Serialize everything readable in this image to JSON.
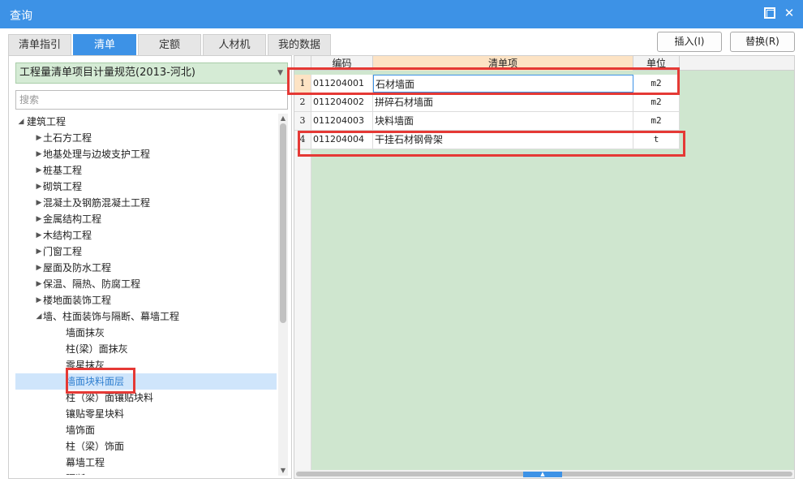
{
  "window": {
    "title": "查询"
  },
  "tabs": [
    {
      "label": "清单指引",
      "active": false
    },
    {
      "label": "清单",
      "active": true
    },
    {
      "label": "定额",
      "active": false
    },
    {
      "label": "人材机",
      "active": false
    },
    {
      "label": "我的数据",
      "active": false
    }
  ],
  "actions": {
    "insert_label": "插入(I)",
    "replace_label": "替换(R)"
  },
  "left": {
    "spec_select": "工程量清单项目计量规范(2013-河北)",
    "search_placeholder": "搜索",
    "tree": [
      {
        "label": "建筑工程",
        "level": 0,
        "state": "expanded"
      },
      {
        "label": "土石方工程",
        "level": 1,
        "state": "collapsed"
      },
      {
        "label": "地基处理与边坡支护工程",
        "level": 1,
        "state": "collapsed"
      },
      {
        "label": "桩基工程",
        "level": 1,
        "state": "collapsed"
      },
      {
        "label": "砌筑工程",
        "level": 1,
        "state": "collapsed"
      },
      {
        "label": "混凝土及钢筋混凝土工程",
        "level": 1,
        "state": "collapsed"
      },
      {
        "label": "金属结构工程",
        "level": 1,
        "state": "collapsed"
      },
      {
        "label": "木结构工程",
        "level": 1,
        "state": "collapsed"
      },
      {
        "label": "门窗工程",
        "level": 1,
        "state": "collapsed"
      },
      {
        "label": "屋面及防水工程",
        "level": 1,
        "state": "collapsed"
      },
      {
        "label": "保温、隔热、防腐工程",
        "level": 1,
        "state": "collapsed"
      },
      {
        "label": "楼地面装饰工程",
        "level": 1,
        "state": "collapsed"
      },
      {
        "label": "墙、柱面装饰与隔断、幕墙工程",
        "level": 1,
        "state": "expanded"
      },
      {
        "label": "墙面抹灰",
        "level": 2,
        "state": "leaf"
      },
      {
        "label": "柱(梁）面抹灰",
        "level": 2,
        "state": "leaf"
      },
      {
        "label": "零星抹灰",
        "level": 2,
        "state": "leaf"
      },
      {
        "label": "墙面块料面层",
        "level": 2,
        "state": "leaf",
        "selected": true
      },
      {
        "label": "柱（梁）面镶贴块料",
        "level": 2,
        "state": "leaf"
      },
      {
        "label": "镶贴零星块料",
        "level": 2,
        "state": "leaf"
      },
      {
        "label": "墙饰面",
        "level": 2,
        "state": "leaf"
      },
      {
        "label": "柱（梁）饰面",
        "level": 2,
        "state": "leaf"
      },
      {
        "label": "幕墙工程",
        "level": 2,
        "state": "leaf"
      },
      {
        "label": "隔断",
        "level": 2,
        "state": "leaf"
      }
    ]
  },
  "grid": {
    "columns": [
      "编码",
      "清单项",
      "单位"
    ],
    "rows": [
      {
        "num": "1",
        "code": "011204001",
        "name": "石材墙面",
        "unit": "m2"
      },
      {
        "num": "2",
        "code": "011204002",
        "name": "拼碎石材墙面",
        "unit": "m2"
      },
      {
        "num": "3",
        "code": "011204003",
        "name": "块料墙面",
        "unit": "m2"
      },
      {
        "num": "4",
        "code": "011204004",
        "name": "干挂石材钢骨架",
        "unit": "t"
      }
    ]
  },
  "icons": {
    "maximize": "maximize-icon",
    "close": "close-icon",
    "expand": "triangle-right-icon",
    "collapse": "triangle-down-icon"
  },
  "colors": {
    "accent": "#3d92e6",
    "grid_background": "#cfe6cf",
    "select_background": "#d5ebd5",
    "selected_row": "#cfe5fb",
    "header_highlight": "#fde3c4",
    "annotation_red": "#e53935"
  }
}
